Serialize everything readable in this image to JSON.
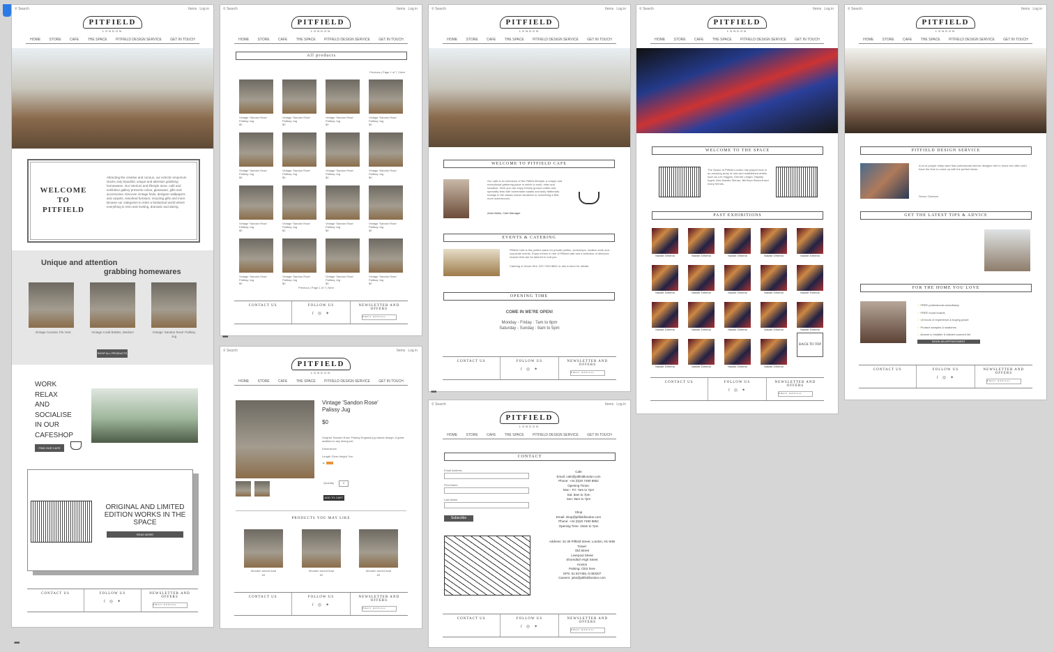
{
  "top": {
    "search": "Search",
    "basket": "Items",
    "login": "Log in"
  },
  "logo": {
    "word": "PITFIELD",
    "city": "LONDON"
  },
  "nav": [
    "HOME",
    "STORE",
    "CAFE",
    "THE SPACE",
    "PITFIELD DESIGN SERVICE",
    "GET IN TOUCH"
  ],
  "home": {
    "welcome": "WELCOME TO PITFIELD",
    "intro": "Attracting the creative and curious, our eclectic emporium stocks only beautiful, unique and attention grabbing homewares. Our interiors and lifestyle store, café and exhibition gallery presents colour, glassware, gifts and accessories. Discover vintage finds, designer wallpapers and carpets, reworked furniture, recycling gifts and more. Browse our categories to enter a fantastical world where everything is retro and riveting, dramatic and daring.",
    "homewares_line1": "Unique and attention",
    "homewares_line2": "grabbing homewares",
    "products": [
      "Vintage Ceramic Pie Vent",
      "Vintage Codd Bottles, Medium",
      "Vintage 'Sandon Rose' Pallissy Jug"
    ],
    "shop_button": "SHOP ALL PRODUCTS",
    "cafe_words": [
      "WORK",
      "RELAX",
      "AND",
      "SOCIALISE",
      "IN OUR",
      "CAFESHOP"
    ],
    "cafe_button": "FIND OUR CAFE",
    "space_text": "ORIGINAL AND LIMITED EDITION WORKS IN THE SPACE",
    "read_more": "READ MORE"
  },
  "footer": {
    "contact": "CONTACT US",
    "follow": "FOLLOW US",
    "newsletter": "NEWSLETTER AND OFFERS",
    "email_placeholder": "Email Address"
  },
  "store": {
    "title": "All products",
    "pager": "Previous | Page 1 of 7 | Next",
    "item": "Vintage 'Sandon Rose' Pallissy Jug",
    "price": "$0"
  },
  "product": {
    "title": "Vintage 'Sandon Rose' Palissy Jug",
    "price": "$0",
    "desc": "Original 'Sandon Rose' Palissy England jug classic design. A great addition to any dining set.",
    "dimensions_label": "Dimensions",
    "dimensions": "Length 20cm Height 7cm",
    "qty_label": "Quantity",
    "qty": "1",
    "add": "ADD TO CART",
    "related_title": "PRODUCTS YOU MAY LIKE",
    "related": [
      "Wooden turned bowl",
      "Wooden turned bowl",
      "Wooden turned bowl"
    ],
    "related_price": "£0"
  },
  "cafe": {
    "welcome": "WELCOME TO PITFIELD CAFE",
    "intro": "Our café is an extension of the Pitfield lifestyle; a unique and exceptional gathering place in which to work, relax and socialise. Here you can enjoy freshly ground coffee and speciality teas with homemade salads and tasty flatbreads. Indulge in the classic bacon sandwich or something a little more adventurous.",
    "signature": "Amel Abbsi, Cafe Manager",
    "events_title": "EVENTS & CATERING",
    "events": "Pitfield Café is the perfect place for private parties, workshops, location work and corporate events. Enjoy menus in hire of Pitfield café and a selection of delicious recipes that can be tailored to suit you.",
    "events_hire": "Catering & Venue Hire: 020 7490 8852 or ask in store for details",
    "opening_title": "OPENING TIME",
    "open_now": "COME IN WE'RE OPEN!",
    "hours1": "Monday - Friday : 7am to 6pm",
    "hours2": "Saturday - Sunday : 9am to 5pm"
  },
  "contact": {
    "title": "CONTACT",
    "email_label": "Email Address",
    "first_label": "First Name",
    "last_label": "Last Name",
    "subscribe": "Subscribe",
    "cafe_lines": [
      "Cafe",
      "Email: cafe@pitfieldlondon.com",
      "Phone: +44 (0)20 7490 8852",
      "Opening Times:",
      "Mon - Fri: 7am to 7pm",
      "Sat: 8am to 7pm",
      "Sun: 9am to 7pm"
    ],
    "shop_lines": [
      "Shop",
      "Email: shop@pitfieldlondon.com",
      "Phone: +44 (0)20 7490 8852",
      "Opening Time: 10am to 7pm"
    ],
    "address_lines": [
      "Address: 31-35 Pitfield Street, London, N1 6HB",
      "Travel:",
      "Old Street",
      "Liverpool Street",
      "Shoreditch High Street",
      "Hoxton",
      "Parking: Click here",
      "GPS: 51.527455,-0.083207",
      "Careers: jobs@pitfieldlondon.com"
    ]
  },
  "space": {
    "welcome": "WELCOME TO THE SPACE",
    "intro": "The Space at Pitfield London has played host to an amazing array of new and established artists such as Lee Higgins, Deirdre Ledger, Slightly Ingrid, Alex Bandle Shirran, Bill Buzz Bennett and many friends.",
    "exhibitions_title": "PAST EXHIBITIONS",
    "artist": "Natalie Dthema",
    "back_to_top": "BACK TO TOP"
  },
  "design": {
    "title": "PITFIELD DESIGN SERVICE",
    "quote": "A lot of people really want that professional interior designer feel in home but often don't have the time to come up with the perfect ideas.",
    "signature": "Simon Clarkson",
    "tips_title": "GET THE LATEST TIPS & ADVICE",
    "home_title": "FOR THE HOME YOU LOVE",
    "ticks": [
      "FREE professional consultancy",
      "FREE mood boards",
      "15 hours of experience & buying power",
      "Product samples & swatches",
      "Access to installer & tailored sourced list"
    ],
    "book": "BOOK AN APPOINTMENT"
  }
}
